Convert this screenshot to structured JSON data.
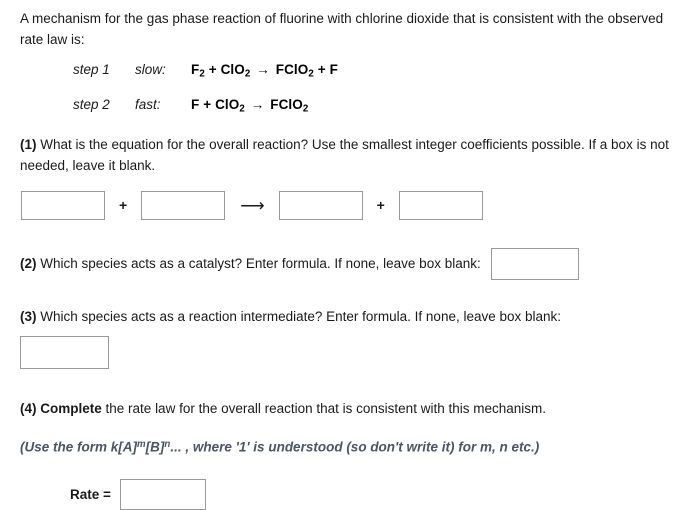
{
  "intro": {
    "text": "A mechanism for the gas phase reaction of fluorine with chlorine dioxide that is consistent with the observed rate law is:"
  },
  "mechanism": {
    "steps": [
      {
        "label": "step 1",
        "rate": "slow:",
        "reactant_1": "F",
        "reactant_1_sub": "2",
        "plus_1": "+",
        "reactant_2": "ClO",
        "reactant_2_sub": "2",
        "arrow": "→",
        "product_1": "FClO",
        "product_1_sub": "2",
        "plus_2": "+",
        "product_2": "F",
        "product_2_sub": ""
      },
      {
        "label": "step 2",
        "rate": "fast:",
        "reactant_1": "F",
        "reactant_1_sub": "",
        "plus_1": "+",
        "reactant_2": "ClO",
        "reactant_2_sub": "2",
        "arrow": "→",
        "product_1": "FClO",
        "product_1_sub": "2",
        "plus_2": "",
        "product_2": "",
        "product_2_sub": ""
      }
    ]
  },
  "questions": {
    "q1": {
      "number": "(1)",
      "text": " What is the equation for the overall reaction? Use the smallest integer coefficients possible. If a box is not needed, leave it blank.",
      "boxes": [
        {
          "name": "reactant-1",
          "value": "",
          "placeholder": ""
        },
        {
          "name": "reactant-2",
          "value": "",
          "placeholder": ""
        },
        {
          "name": "product-1",
          "value": "",
          "placeholder": ""
        },
        {
          "name": "product-2",
          "value": "",
          "placeholder": ""
        }
      ],
      "plus_1": "+",
      "arrow": "⟶",
      "plus_2": "+"
    },
    "q2": {
      "number": "(2)",
      "text": " Which species acts as a catalyst? Enter formula. If none, leave box blank:",
      "box": {
        "value": "",
        "placeholder": ""
      }
    },
    "q3": {
      "number": "(3)",
      "text": " Which species acts as a reaction intermediate? Enter formula. If none, leave box blank:",
      "box": {
        "value": "",
        "placeholder": ""
      }
    },
    "q4": {
      "number": "(4)",
      "bold_word": "Complete",
      "text": " the rate law for the overall reaction that is consistent with this mechanism.",
      "hint_part_1": "(Use the form k[A]",
      "hint_sup_1": "m",
      "hint_part_2": "[B]",
      "hint_sup_2": "n",
      "hint_part_3": "... , where '1' is understood (so don't write it) for m, n etc.)",
      "rate_label": "Rate =",
      "box": {
        "value": "",
        "placeholder": ""
      }
    }
  },
  "colors": {
    "text": "#1a1a1a",
    "hint": "#4a5568",
    "box_border": "#9a9a9a",
    "background": "#ffffff"
  }
}
